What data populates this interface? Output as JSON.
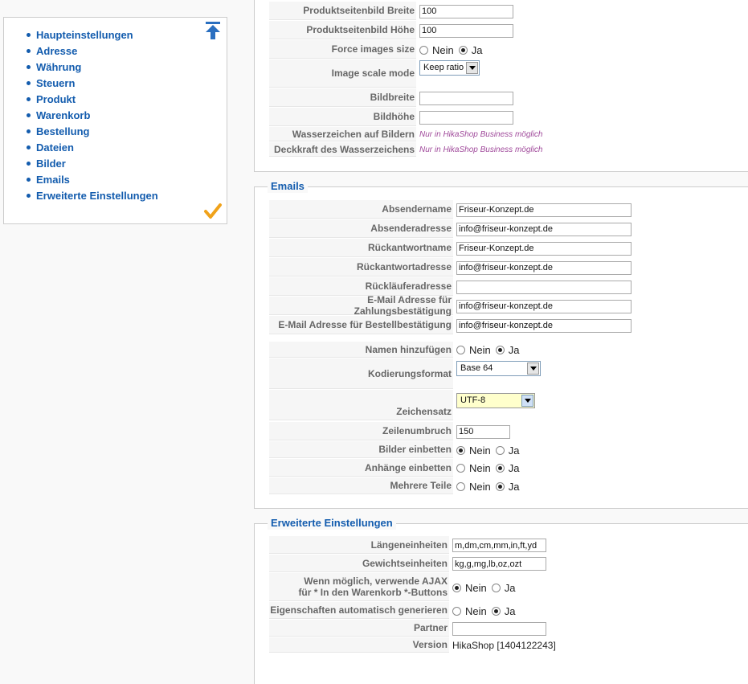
{
  "nav": {
    "items": [
      {
        "label": "Haupteinstellungen"
      },
      {
        "label": "Adresse"
      },
      {
        "label": "Währung"
      },
      {
        "label": "Steuern"
      },
      {
        "label": "Produkt"
      },
      {
        "label": "Warenkorb"
      },
      {
        "label": "Bestellung"
      },
      {
        "label": "Dateien"
      },
      {
        "label": "Bilder"
      },
      {
        "label": "Emails"
      },
      {
        "label": "Erweiterte Einstellungen"
      }
    ],
    "top_icon": "arrow-up-to-top-icon",
    "check_icon": "checkmark-icon"
  },
  "radio_labels": {
    "no": "Nein",
    "yes": "Ja"
  },
  "images": {
    "product_width_label": "Produktseitenbild Breite",
    "product_width_value": "100",
    "product_height_label": "Produktseitenbild Höhe",
    "product_height_value": "100",
    "force_size_label": "Force images size",
    "force_size_value": "Ja",
    "scale_mode_label": "Image scale mode",
    "scale_mode_value": "Keep ratio",
    "width_label": "Bildbreite",
    "width_value": "",
    "height_label": "Bildhöhe",
    "height_value": "",
    "watermark_label": "Wasserzeichen auf Bildern",
    "watermark_note": "Nur in HikaShop Business möglich",
    "opacity_label": "Deckkraft des Wasserzeichens",
    "opacity_note": "Nur in HikaShop Business möglich"
  },
  "emails": {
    "legend": "Emails",
    "sender_name_label": "Absendername",
    "sender_name_value": "Friseur-Konzept.de",
    "sender_address_label": "Absenderadresse",
    "sender_address_value": "info@friseur-konzept.de",
    "reply_name_label": "Rückantwortname",
    "reply_name_value": "Friseur-Konzept.de",
    "reply_address_label": "Rückantwortadresse",
    "reply_address_value": "info@friseur-konzept.de",
    "bounce_label": "Rückläuferadresse",
    "bounce_value": "",
    "payment_notif_label": "E-Mail Adresse für Zahlungsbestätigung",
    "payment_notif_value": "info@friseur-konzept.de",
    "order_notif_label": "E-Mail Adresse für Bestellbestätigung",
    "order_notif_value": "info@friseur-konzept.de",
    "add_names_label": "Namen hinzufügen",
    "add_names_value": "Ja",
    "encoding_label": "Kodierungsformat",
    "encoding_value": "Base 64",
    "charset_label": "Zeichensatz",
    "charset_value": "UTF-8",
    "word_wrap_label": "Zeilenumbruch",
    "word_wrap_value": "150",
    "embed_images_label": "Bilder einbetten",
    "embed_images_value": "Nein",
    "embed_attach_label": "Anhänge einbetten",
    "embed_attach_value": "Ja",
    "multiple_parts_label": "Mehrere Teile",
    "multiple_parts_value": "Ja"
  },
  "advanced": {
    "legend": "Erweiterte Einstellungen",
    "length_units_label": "Längeneinheiten",
    "length_units_value": "m,dm,cm,mm,in,ft,yd",
    "weight_units_label": "Gewichtseinheiten",
    "weight_units_value": "kg,g,mg,lb,oz,ozt",
    "ajax_label_line1": "Wenn möglich, verwende AJAX",
    "ajax_label_line2": "für * In den Warenkorb *-Buttons",
    "ajax_value": "Nein",
    "auto_props_label": "Eigenschaften automatisch generieren",
    "auto_props_value": "Ja",
    "partner_label": "Partner",
    "partner_value": "",
    "version_label": "Version",
    "version_value": "HikaShop [1404122243]"
  }
}
